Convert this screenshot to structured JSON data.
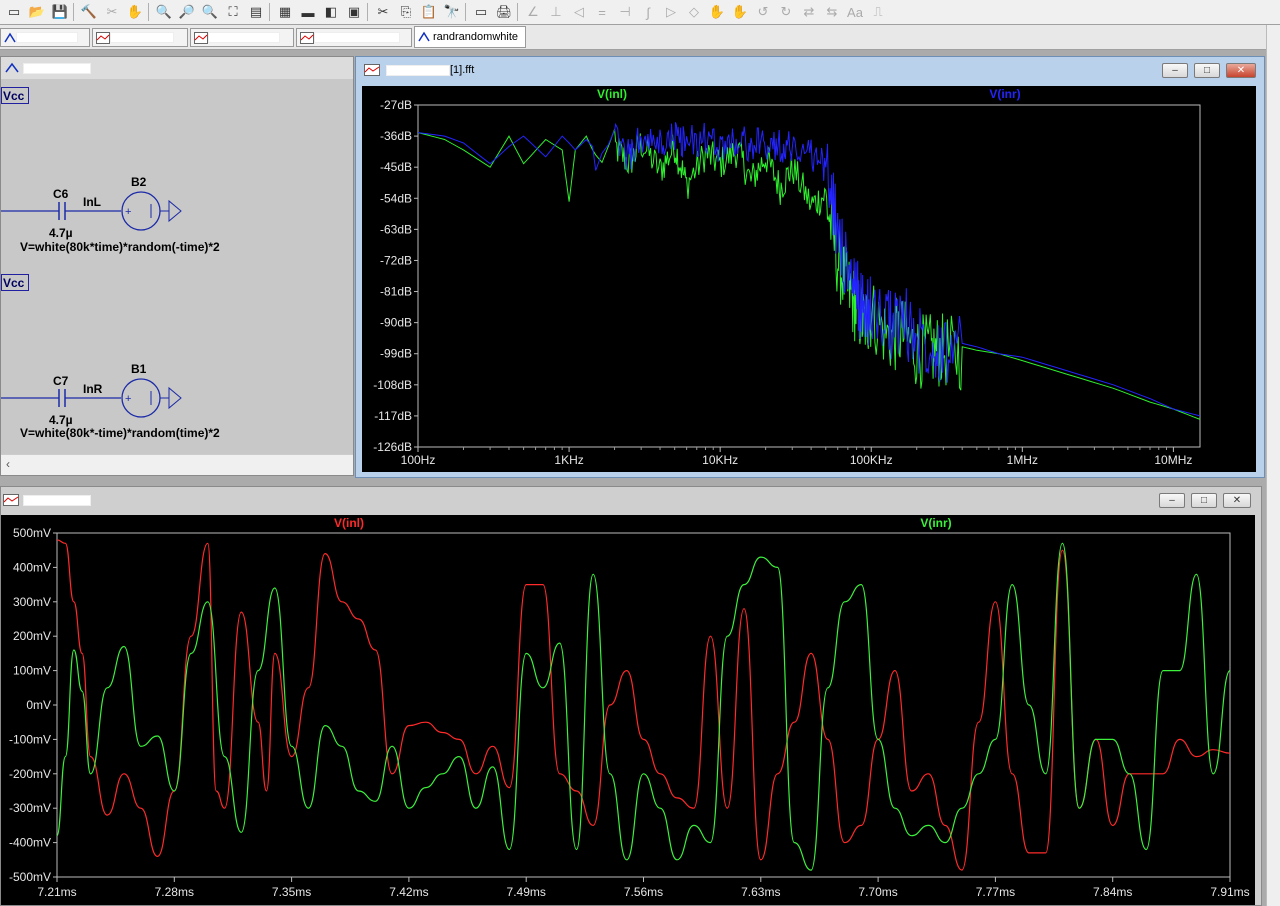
{
  "toolbar": {
    "icons": [
      "new-schematic-icon",
      "open-icon",
      "save-icon",
      "control-panel-icon",
      "run-icon",
      "halt-icon",
      "zoom-in-icon",
      "zoom-box-icon",
      "zoom-out-icon",
      "zoom-fit-icon",
      "autorange-icon",
      "pick-traces-icon",
      "tile-horizontal-icon",
      "tile-vertical-icon",
      "cascade-icon",
      "cut-icon",
      "copy-icon",
      "paste-icon",
      "find-icon",
      "print-setup-icon",
      "print-icon",
      "wire-icon",
      "ground-icon",
      "label-icon",
      "resistor-icon",
      "capacitor-icon",
      "inductor-icon",
      "diode-icon",
      "component-icon",
      "move-icon",
      "drag-icon",
      "undo-icon",
      "redo-icon",
      "rotate-icon",
      "mirror-icon",
      "text-icon",
      "spice-directive-icon"
    ]
  },
  "tabs": [
    {
      "label": ""
    },
    {
      "label": ""
    },
    {
      "label": ""
    },
    {
      "label": ""
    },
    {
      "label": "randrandomwhite"
    }
  ],
  "schematic": {
    "title": "",
    "vcc1": "Vcc",
    "vcc2": "Vcc",
    "c6_name": "C6",
    "c6_value": "4.7µ",
    "net1": "InL",
    "b2_name": "B2",
    "b2_expr": "V=white(80k*time)*random(-time)*2",
    "c7_name": "C7",
    "c7_value": "4.7µ",
    "net2": "InR",
    "b1_name": "B1",
    "b1_expr": "V=white(80k*-time)*random(time)*2",
    "scroll_arrow": "‹"
  },
  "fft_window": {
    "title_suffix": "[1].fft",
    "controls": {
      "minimize": "–",
      "maximize": "□",
      "close": "✕"
    }
  },
  "time_window": {
    "title": "",
    "controls": {
      "minimize": "–",
      "maximize": "□",
      "close": "✕"
    }
  },
  "chart_data": [
    {
      "type": "line",
      "title": "",
      "xscale": "log",
      "x_ticks": [
        "100Hz",
        "1KHz",
        "10KHz",
        "100KHz",
        "1MHz",
        "10MHz"
      ],
      "xlim": [
        100,
        15000000
      ],
      "y_ticks": [
        "-27dB",
        "-36dB",
        "-45dB",
        "-54dB",
        "-63dB",
        "-72dB",
        "-81dB",
        "-90dB",
        "-99dB",
        "-108dB",
        "-117dB",
        "-126dB"
      ],
      "ylim": [
        -126,
        -27
      ],
      "background": "#000000",
      "grid": false,
      "legend": "top",
      "series": [
        {
          "name": "V(inl)",
          "color": "#2ef02e",
          "x": [
            100,
            150,
            200,
            300,
            400,
            500,
            700,
            900,
            1000,
            1100,
            1300,
            1500,
            2000,
            2500,
            3000,
            4000,
            5000,
            6000,
            8000,
            10000,
            13000,
            16000,
            20000,
            25000,
            30000,
            40000,
            50000,
            60000,
            70000,
            80000,
            90000,
            100000,
            130000,
            160000,
            200000,
            250000,
            300000,
            400000,
            500000,
            700000,
            1000000,
            2000000,
            4000000,
            7000000,
            10000000,
            15000000
          ],
          "y": [
            -35,
            -37,
            -40,
            -45,
            -36,
            -44,
            -37,
            -40,
            -55,
            -40,
            -36,
            -42,
            -38,
            -43,
            -37,
            -45,
            -38,
            -49,
            -40,
            -43,
            -39,
            -48,
            -41,
            -50,
            -44,
            -55,
            -52,
            -70,
            -78,
            -84,
            -88,
            -85,
            -92,
            -91,
            -96,
            -96,
            -96,
            -97,
            -98,
            -99,
            -101,
            -105,
            -109,
            -113,
            -115,
            -118
          ]
        },
        {
          "name": "V(inr)",
          "color": "#2424ff",
          "x": [
            100,
            150,
            200,
            300,
            400,
            500,
            700,
            900,
            1000,
            1100,
            1300,
            1500,
            2000,
            2500,
            3000,
            4000,
            5000,
            6000,
            8000,
            10000,
            13000,
            16000,
            20000,
            25000,
            30000,
            40000,
            50000,
            60000,
            70000,
            80000,
            90000,
            100000,
            130000,
            160000,
            200000,
            250000,
            300000,
            400000,
            500000,
            700000,
            1000000,
            2000000,
            4000000,
            7000000,
            10000000,
            15000000
          ],
          "y": [
            -35,
            -36,
            -38,
            -44,
            -39,
            -36,
            -42,
            -36,
            -38,
            -40,
            -37,
            -40,
            -36,
            -41,
            -36,
            -38,
            -35,
            -37,
            -36,
            -38,
            -36,
            -38,
            -37,
            -38,
            -38,
            -40,
            -44,
            -60,
            -74,
            -80,
            -84,
            -84,
            -88,
            -87,
            -92,
            -93,
            -95,
            -96,
            -97,
            -99,
            -100,
            -104,
            -108,
            -112,
            -115,
            -117
          ]
        }
      ]
    },
    {
      "type": "line",
      "title": "",
      "x_ticks": [
        "7.21ms",
        "7.28ms",
        "7.35ms",
        "7.42ms",
        "7.49ms",
        "7.56ms",
        "7.63ms",
        "7.70ms",
        "7.77ms",
        "7.84ms",
        "7.91ms"
      ],
      "xlim": [
        7.21,
        7.91
      ],
      "y_ticks": [
        "500mV",
        "400mV",
        "300mV",
        "200mV",
        "100mV",
        "0mV",
        "-100mV",
        "-200mV",
        "-300mV",
        "-400mV",
        "-500mV"
      ],
      "ylim": [
        -500,
        500
      ],
      "background": "#000000",
      "grid": false,
      "legend": "top",
      "series": [
        {
          "name": "V(inl)",
          "color": "#ff2a2a",
          "x": [
            7.21,
            7.215,
            7.22,
            7.225,
            7.23,
            7.24,
            7.25,
            7.26,
            7.27,
            7.28,
            7.29,
            7.3,
            7.305,
            7.31,
            7.32,
            7.33,
            7.335,
            7.34,
            7.35,
            7.36,
            7.37,
            7.38,
            7.39,
            7.4,
            7.41,
            7.42,
            7.43,
            7.44,
            7.45,
            7.46,
            7.47,
            7.48,
            7.49,
            7.5,
            7.51,
            7.52,
            7.53,
            7.54,
            7.55,
            7.56,
            7.57,
            7.58,
            7.59,
            7.6,
            7.61,
            7.62,
            7.63,
            7.64,
            7.65,
            7.66,
            7.67,
            7.68,
            7.69,
            7.7,
            7.71,
            7.72,
            7.73,
            7.74,
            7.75,
            7.76,
            7.77,
            7.78,
            7.79,
            7.8,
            7.81,
            7.82,
            7.83,
            7.84,
            7.85,
            7.86,
            7.87,
            7.88,
            7.89,
            7.9,
            7.91
          ],
          "y": [
            480,
            470,
            300,
            150,
            -150,
            -320,
            -200,
            -300,
            -440,
            -250,
            200,
            470,
            -250,
            -300,
            270,
            -50,
            -250,
            150,
            -150,
            50,
            440,
            300,
            250,
            160,
            -200,
            -60,
            -50,
            -80,
            -100,
            -200,
            -120,
            -240,
            350,
            350,
            -200,
            -250,
            -350,
            0,
            100,
            -100,
            -200,
            -270,
            -300,
            200,
            -300,
            280,
            -450,
            -200,
            -50,
            150,
            -100,
            -400,
            -350,
            -100,
            100,
            -250,
            -200,
            -350,
            -480,
            -50,
            300,
            -200,
            -430,
            -430,
            450,
            -300,
            -100,
            -350,
            -200,
            -200,
            -200,
            -100,
            -150,
            -130,
            -140
          ]
        },
        {
          "name": "V(inr)",
          "color": "#3cf03c",
          "x": [
            7.21,
            7.215,
            7.22,
            7.225,
            7.23,
            7.24,
            7.25,
            7.26,
            7.27,
            7.28,
            7.29,
            7.3,
            7.31,
            7.32,
            7.33,
            7.34,
            7.35,
            7.36,
            7.37,
            7.38,
            7.39,
            7.4,
            7.41,
            7.42,
            7.43,
            7.44,
            7.45,
            7.46,
            7.47,
            7.48,
            7.49,
            7.5,
            7.51,
            7.52,
            7.53,
            7.54,
            7.55,
            7.56,
            7.57,
            7.58,
            7.59,
            7.6,
            7.61,
            7.62,
            7.63,
            7.64,
            7.65,
            7.66,
            7.67,
            7.68,
            7.69,
            7.7,
            7.71,
            7.72,
            7.73,
            7.74,
            7.75,
            7.76,
            7.77,
            7.78,
            7.79,
            7.8,
            7.81,
            7.82,
            7.83,
            7.84,
            7.85,
            7.86,
            7.87,
            7.88,
            7.89,
            7.9,
            7.91
          ],
          "y": [
            -380,
            -150,
            160,
            40,
            -200,
            50,
            170,
            -120,
            -90,
            -250,
            150,
            300,
            -150,
            -370,
            100,
            340,
            -120,
            -300,
            -60,
            -120,
            -250,
            -280,
            -120,
            -300,
            -240,
            -200,
            -150,
            -300,
            -180,
            -420,
            150,
            50,
            180,
            -420,
            380,
            -200,
            -450,
            -200,
            -300,
            -450,
            -350,
            -400,
            200,
            350,
            430,
            400,
            -400,
            -480,
            50,
            300,
            350,
            -100,
            -300,
            -380,
            -350,
            -400,
            -300,
            -200,
            -100,
            350,
            0,
            -200,
            470,
            -300,
            -100,
            -100,
            -200,
            -420,
            100,
            100,
            380,
            -200,
            100
          ]
        }
      ]
    }
  ]
}
